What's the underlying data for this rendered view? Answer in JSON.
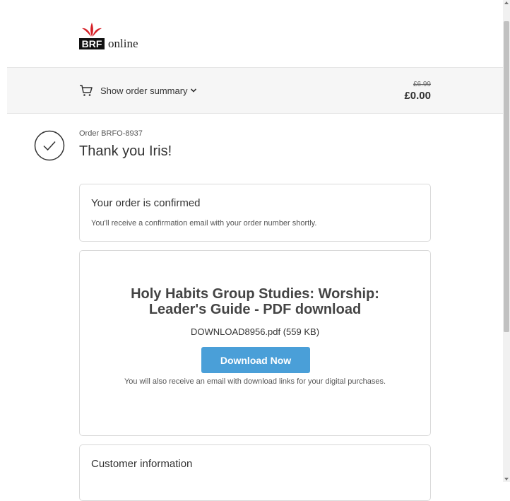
{
  "header": {
    "logo_mark_text": "BRF",
    "logo_text": "online",
    "brand_red": "#d62027"
  },
  "summary": {
    "toggle_label": "Show order summary",
    "cart_icon": "cart-icon",
    "chevron_icon": "chevron-down-icon",
    "original_price": "£6.99",
    "total_price": "£0.00"
  },
  "order": {
    "number_text": "Order BRFO-8937",
    "thanks_text": "Thank you Iris!",
    "status_icon": "checkmark-circle-icon"
  },
  "confirmation": {
    "title": "Your order is confirmed",
    "text": "You'll receive a confirmation email with your order number shortly."
  },
  "download": {
    "product_title": "Holy Habits Group Studies: Worship: Leader's Guide - PDF download",
    "file_text": "DOWNLOAD8956.pdf (559 KB)",
    "button_label": "Download Now",
    "button_color": "#4a9fd8",
    "note": "You will also receive an email with download links for your digital purchases."
  },
  "customer": {
    "title": "Customer information"
  }
}
